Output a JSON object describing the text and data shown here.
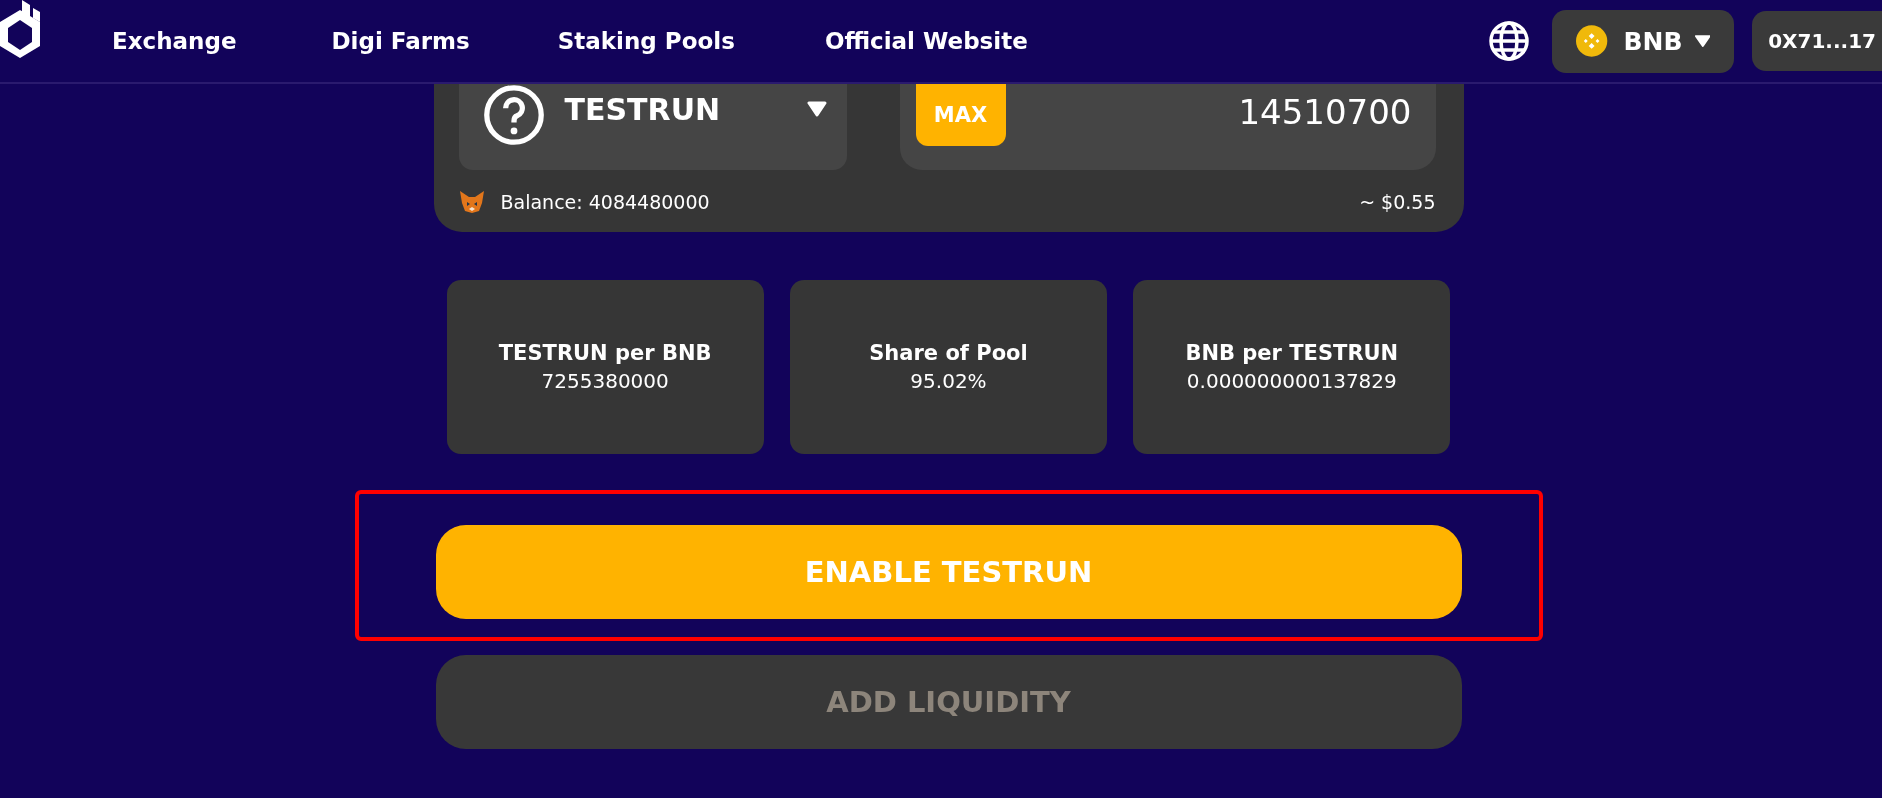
{
  "nav": {
    "links": [
      "Exchange",
      "Digi Farms",
      "Staking Pools",
      "Official Website"
    ],
    "network": "BNB",
    "account": "0X71...17"
  },
  "input": {
    "token": "TESTRUN",
    "max": "MAX",
    "amount": "14510700",
    "balance": "Balance: 4084480000",
    "usd": "~ $0.55"
  },
  "stats": [
    {
      "label": "TESTRUN per BNB",
      "value": "7255380000"
    },
    {
      "label": "Share of Pool",
      "value": "95.02%"
    },
    {
      "label": "BNB per TESTRUN",
      "value": "0.000000000137829"
    }
  ],
  "actions": [
    {
      "label": "ENABLE TESTRUN",
      "disabled": false,
      "highlighted": true
    },
    {
      "label": "ADD LIQUIDITY",
      "disabled": true,
      "highlighted": false
    }
  ]
}
